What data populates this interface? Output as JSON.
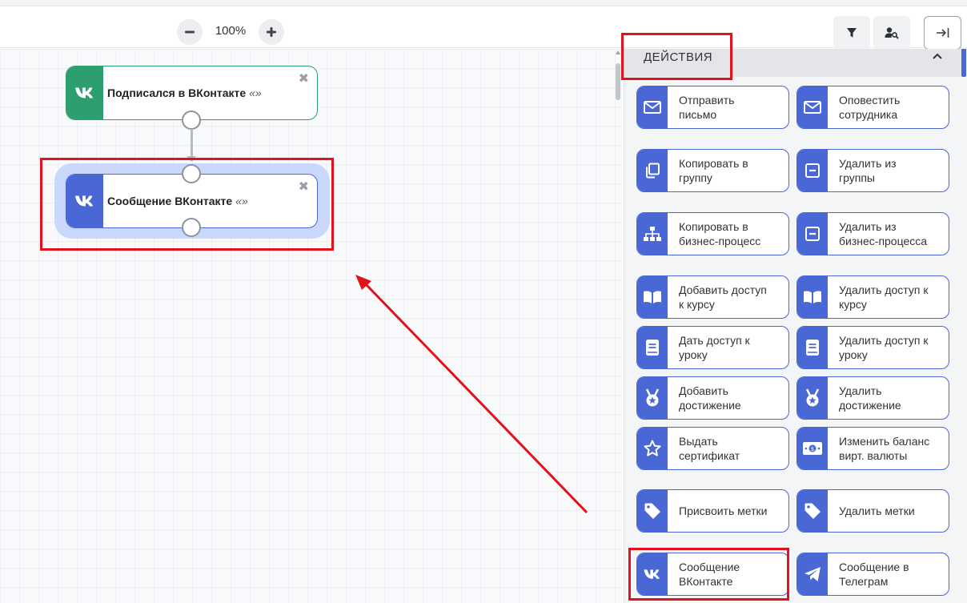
{
  "toolbar": {
    "zoom_out_icon": "minus-icon",
    "zoom_level": "100%",
    "zoom_in_icon": "plus-icon",
    "filter_icon": "filter-icon",
    "user_search_icon": "user-search-icon",
    "exit_icon": "exit-to-right-icon"
  },
  "canvas": {
    "nodes": [
      {
        "title": "Подписался в ВКонтакте",
        "suffix": "«»",
        "color": "#2d9e6f"
      },
      {
        "title": "Сообщение ВКонтакте",
        "suffix": "«»",
        "color": "#4a67d6"
      }
    ]
  },
  "panel": {
    "section_title": "ДЕЙСТВИЯ",
    "actions": [
      {
        "label": "Отправить\nписьмо",
        "icon": "envelope-icon"
      },
      {
        "label": "Оповестить\nсотрудника",
        "icon": "envelope-icon"
      },
      {
        "label": "Копировать в\nгруппу",
        "icon": "copy-icon"
      },
      {
        "label": "Удалить из\nгруппы",
        "icon": "minus-box-icon"
      },
      {
        "label": "Копировать в\nбизнес-процесс",
        "icon": "sitemap-icon"
      },
      {
        "label": "Удалить из\nбизнес-процесса",
        "icon": "minus-box-icon"
      },
      {
        "label": "Добавить доступ\nк курсу",
        "icon": "book-open-icon"
      },
      {
        "label": "Удалить доступ к\nкурсу",
        "icon": "book-open-icon"
      },
      {
        "label": "Дать доступ к\nуроку",
        "icon": "book-icon"
      },
      {
        "label": "Удалить доступ к\nуроку",
        "icon": "book-icon"
      },
      {
        "label": "Добавить\nдостижение",
        "icon": "medal-icon"
      },
      {
        "label": "Удалить\nдостижение",
        "icon": "medal-icon"
      },
      {
        "label": "Выдать\nсертификат",
        "icon": "star-icon"
      },
      {
        "label": "Изменить баланс\nвирт. валюты",
        "icon": "money-bill-icon"
      },
      {
        "label": "Присвоить метки",
        "icon": "tag-icon"
      },
      {
        "label": "Удалить метки",
        "icon": "tag-icon"
      },
      {
        "label": "Сообщение\nВКонтакте",
        "icon": "vk-icon"
      },
      {
        "label": "Сообщение в\nТелеграм",
        "icon": "telegram-icon"
      }
    ]
  },
  "colors": {
    "accent": "#4a67d6",
    "trigger_green": "#2d9e6f",
    "selection_halo": "#c9d8fb",
    "highlight_red": "#e0121b"
  }
}
